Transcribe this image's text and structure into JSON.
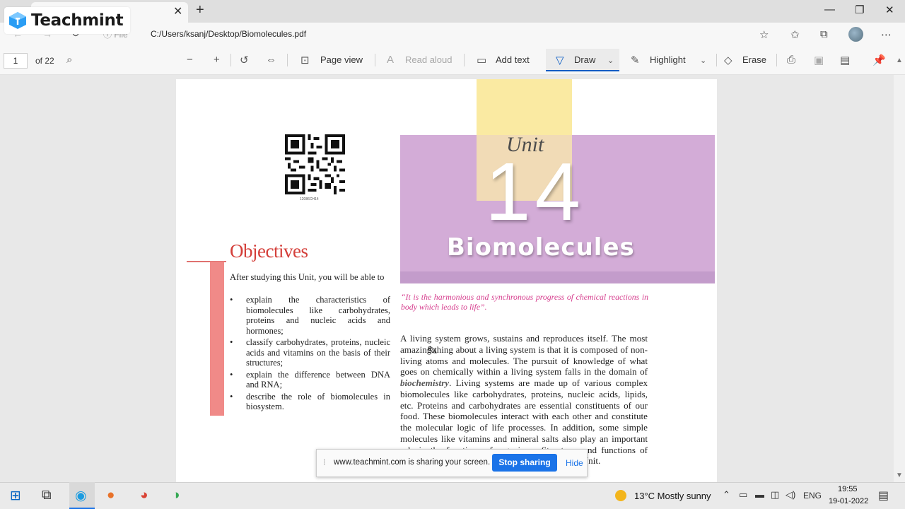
{
  "browser": {
    "url": "C:/Users/ksanj/Desktop/Biomolecules.pdf",
    "url_chip": "File",
    "icons": [
      "back-icon",
      "forward-icon",
      "refresh-icon",
      "add-favorite-icon",
      "favorites-icon",
      "collections-icon",
      "profile-icon",
      "more-icon"
    ]
  },
  "brand": {
    "name": "Teachmint"
  },
  "pdf_toolbar": {
    "page_current": "1",
    "page_count": "of 22",
    "page_view": "Page view",
    "read_aloud": "Read aloud",
    "add_text": "Add text",
    "draw": "Draw",
    "highlight": "Highlight",
    "erase": "Erase"
  },
  "document": {
    "qr_code_text": "12086CH14",
    "unit_label": "Unit",
    "unit_number": "14",
    "unit_title": "Biomolecules",
    "objectives_title": "Objectives",
    "objectives_intro": "After studying this Unit, you will be able to",
    "objectives": [
      "explain the characteristics of biomolecules like carbohydrates, proteins and nucleic acids and hormones;",
      "classify carbohydrates, proteins, nucleic acids and vitamins on the basis of their structures;",
      "explain the difference between DNA and RNA;",
      "describe the role of biomolecules in biosystem."
    ],
    "quote": "“It is the harmonious and synchronous progress of chemical reactions in body which leads to life”.",
    "body_part1": "A living system grows, sustains and reproduces itself. The most amazing thing about a living system is that it is composed of non-living atoms and molecules. The pursuit of knowledge of what goes on chemically within a living system falls in the domain of",
    "body_em": "biochemistry",
    "body_part2": ". Living systems are made up of various complex biomolecules like carbohydrates, proteins, nucleic acids, lipids, etc. Proteins and carbohydrates are essential constituents of our food. These biomolecules interact with each other and constitute the molecular logic of life processes. In addition, some simple molecules like vitamins and mineral salts also play an important role in the functions of organisms. Structures and functions of some of these biomolecules are discussed in this Unit."
  },
  "share_bar": {
    "message": "www.teachmint.com is sharing your screen.",
    "stop": "Stop sharing",
    "hide": "Hide"
  },
  "taskbar": {
    "weather": "13°C  Mostly sunny",
    "language": "ENG",
    "time": "19:55",
    "date": "19-01-2022"
  },
  "colors": {
    "accent": "#1a73e8",
    "unit_purple": "#d3acd7",
    "unit_yellow": "#faeaa2",
    "objectives_red": "#d43f3a",
    "quote_pink": "#d63e8e"
  }
}
